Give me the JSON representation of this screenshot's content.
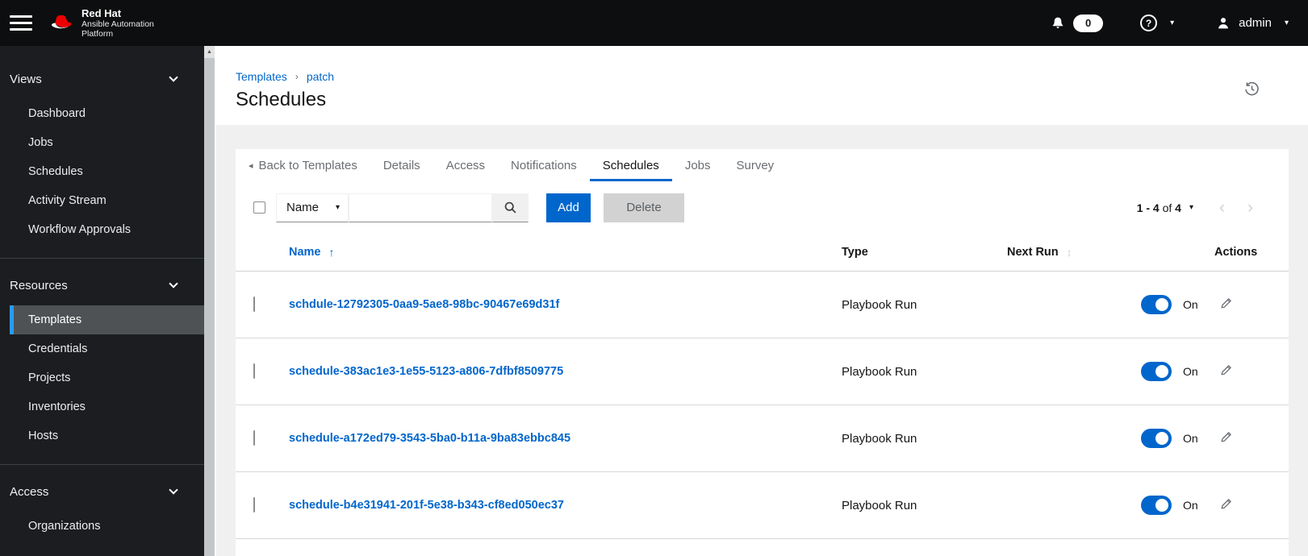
{
  "masthead": {
    "brand_line1": "Red Hat",
    "brand_line2": "Ansible Automation",
    "brand_line3": "Platform",
    "notification_count": "0",
    "help_symbol": "?",
    "username": "admin"
  },
  "sidebar": {
    "groups": [
      {
        "label": "Views",
        "items": [
          {
            "label": "Dashboard"
          },
          {
            "label": "Jobs"
          },
          {
            "label": "Schedules"
          },
          {
            "label": "Activity Stream"
          },
          {
            "label": "Workflow Approvals"
          }
        ]
      },
      {
        "label": "Resources",
        "items": [
          {
            "label": "Templates",
            "selected": true
          },
          {
            "label": "Credentials"
          },
          {
            "label": "Projects"
          },
          {
            "label": "Inventories"
          },
          {
            "label": "Hosts"
          }
        ]
      },
      {
        "label": "Access",
        "items": [
          {
            "label": "Organizations"
          }
        ]
      }
    ]
  },
  "page": {
    "breadcrumb_1": "Templates",
    "breadcrumb_2": "patch",
    "title": "Schedules"
  },
  "tabs": {
    "back_label": "Back to Templates",
    "items": [
      {
        "label": "Details",
        "active": false
      },
      {
        "label": "Access",
        "active": false
      },
      {
        "label": "Notifications",
        "active": false
      },
      {
        "label": "Schedules",
        "active": true
      },
      {
        "label": "Jobs",
        "active": false
      },
      {
        "label": "Survey",
        "active": false
      }
    ]
  },
  "toolbar": {
    "filter_selected": "Name",
    "search_value": "",
    "add_label": "Add",
    "delete_label": "Delete"
  },
  "pagination": {
    "range": "1 - 4",
    "of_label": "of",
    "total": "4"
  },
  "table": {
    "headers": {
      "name": "Name",
      "type": "Type",
      "next_run": "Next Run",
      "actions": "Actions"
    },
    "rows": [
      {
        "name": "schdule-12792305-0aa9-5ae8-98bc-90467e69d31f",
        "type": "Playbook Run",
        "toggle_state": "On"
      },
      {
        "name": "schedule-383ac1e3-1e55-5123-a806-7dfbf8509775",
        "type": "Playbook Run",
        "toggle_state": "On"
      },
      {
        "name": "schedule-a172ed79-3543-5ba0-b11a-9ba83ebbc845",
        "type": "Playbook Run",
        "toggle_state": "On"
      },
      {
        "name": "schedule-b4e31941-201f-5e38-b343-cf8ed050ec37",
        "type": "Playbook Run",
        "toggle_state": "On"
      }
    ]
  },
  "icons": {
    "back_triangle": "◂",
    "caret_down": "▾",
    "breadcrumb_sep": "›",
    "sort_ascending": "↑",
    "sort_updown": "↕",
    "chevron_left": "‹",
    "chevron_right": "›",
    "scroll_up": "▲"
  },
  "colors": {
    "accent": "#0066cc",
    "masthead_bg": "#0d0e0f",
    "sidebar_bg": "#1b1d21",
    "selected_nav_bg": "#4f5255",
    "selected_nav_border": "#2b9af3",
    "link": "#0066cc",
    "toggle_on": "#0066cc",
    "disabled_button_bg": "#d2d2d2",
    "page_bg": "#f0f0f0",
    "brand_red": "#ee0000"
  }
}
